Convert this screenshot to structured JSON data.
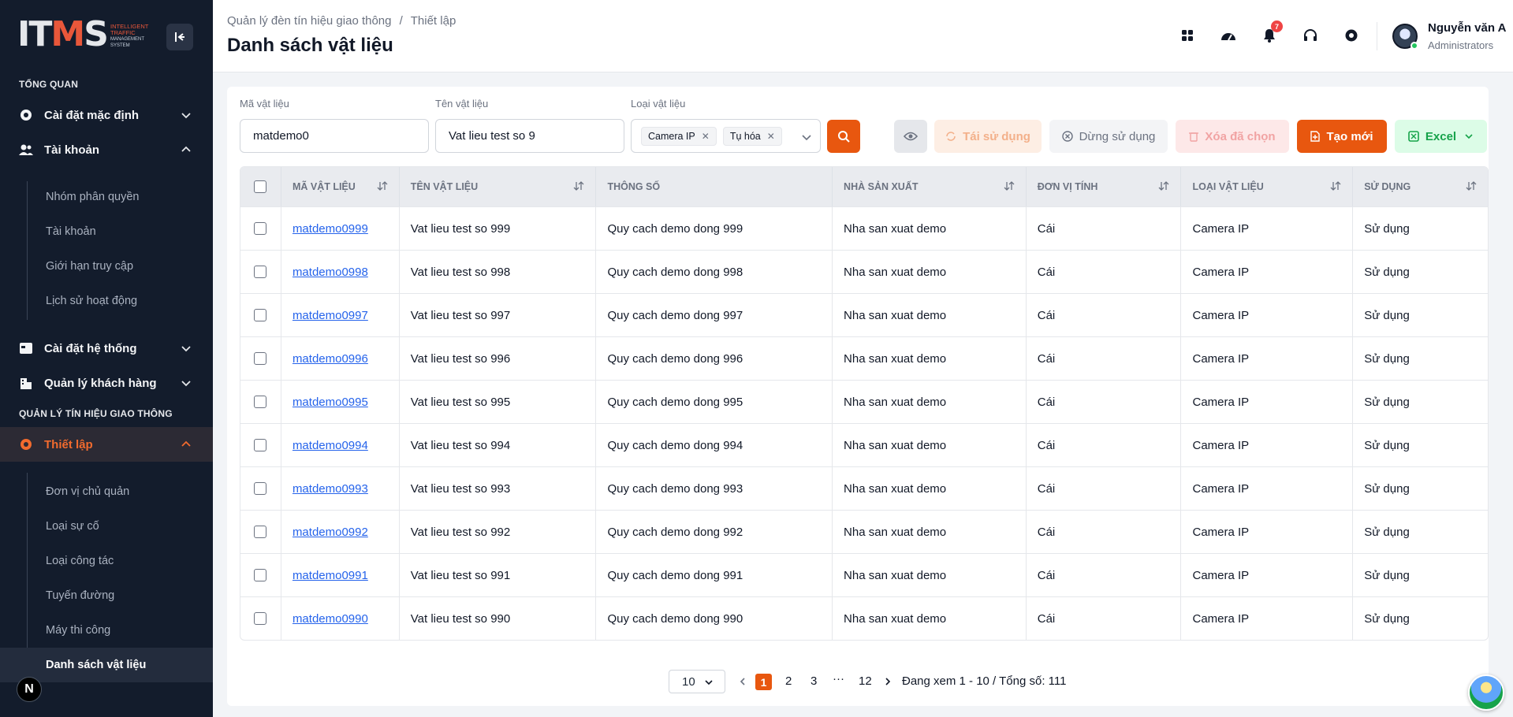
{
  "logo": {
    "main_a": "IT",
    "main_b": "M",
    "main_c": "S",
    "sub1": "INTELLIGENT",
    "sub2": "TRAFFIC",
    "sub3": "MANAGEMENT",
    "sub4": "SYSTEM"
  },
  "sidebar": {
    "section_overview": "TỔNG QUAN",
    "menu_default_settings": "Cài đặt mặc định",
    "menu_account": "Tài khoản",
    "account_sub": [
      "Nhóm phân quyền",
      "Tài khoản",
      "Giới hạn truy cập",
      "Lịch sử hoạt động"
    ],
    "menu_system_settings": "Cài đặt hệ thống",
    "menu_customers": "Quản lý khách hàng",
    "section_traffic": "QUẢN LÝ TÍN HIỆU GIAO THÔNG",
    "menu_setup": "Thiết lập",
    "setup_sub": [
      "Đơn vị chủ quản",
      "Loại sự cố",
      "Loại công tác",
      "Tuyến đường",
      "Máy thi công",
      "Danh sách vật liệu"
    ],
    "n_badge": "N"
  },
  "header": {
    "breadcrumb_root": "Quản lý đèn tín hiệu giao thông",
    "breadcrumb_sep": "/",
    "breadcrumb_current": "Thiết lập",
    "page_title": "Danh sách vật liệu",
    "notification_count": "7",
    "user_name": "Nguyễn văn A",
    "user_role": "Administrators"
  },
  "filters": {
    "code_label": "Mã vật liệu",
    "code_value": "matdemo0",
    "name_label": "Tên vật liệu",
    "name_value": "Vat lieu test so 9",
    "type_label": "Loại vật liệu",
    "type_tags": [
      "Camera IP",
      "Tụ hóa"
    ]
  },
  "toolbar": {
    "reuse_label": "Tái sử dụng",
    "stop_label": "Dừng sử dụng",
    "delete_label": "Xóa đã chọn",
    "create_label": "Tạo mới",
    "excel_label": "Excel"
  },
  "colors": {
    "accent": "#e8570f",
    "sidebar_bg": "#131c2c",
    "link": "#2563eb"
  },
  "table": {
    "headers": [
      "MÃ VẬT LIỆU",
      "TÊN VẬT LIỆU",
      "THÔNG SỐ",
      "NHÀ SẢN XUẤT",
      "ĐƠN VỊ TÍNH",
      "LOẠI VẬT LIỆU",
      "SỬ DỤNG"
    ],
    "rows": [
      [
        "matdemo0999",
        "Vat lieu test so 999",
        "Quy cach demo dong 999",
        "Nha san xuat demo",
        "Cái",
        "Camera IP",
        "Sử dụng"
      ],
      [
        "matdemo0998",
        "Vat lieu test so 998",
        "Quy cach demo dong 998",
        "Nha san xuat demo",
        "Cái",
        "Camera IP",
        "Sử dụng"
      ],
      [
        "matdemo0997",
        "Vat lieu test so 997",
        "Quy cach demo dong 997",
        "Nha san xuat demo",
        "Cái",
        "Camera IP",
        "Sử dụng"
      ],
      [
        "matdemo0996",
        "Vat lieu test so 996",
        "Quy cach demo dong 996",
        "Nha san xuat demo",
        "Cái",
        "Camera IP",
        "Sử dụng"
      ],
      [
        "matdemo0995",
        "Vat lieu test so 995",
        "Quy cach demo dong 995",
        "Nha san xuat demo",
        "Cái",
        "Camera IP",
        "Sử dụng"
      ],
      [
        "matdemo0994",
        "Vat lieu test so 994",
        "Quy cach demo dong 994",
        "Nha san xuat demo",
        "Cái",
        "Camera IP",
        "Sử dụng"
      ],
      [
        "matdemo0993",
        "Vat lieu test so 993",
        "Quy cach demo dong 993",
        "Nha san xuat demo",
        "Cái",
        "Camera IP",
        "Sử dụng"
      ],
      [
        "matdemo0992",
        "Vat lieu test so 992",
        "Quy cach demo dong 992",
        "Nha san xuat demo",
        "Cái",
        "Camera IP",
        "Sử dụng"
      ],
      [
        "matdemo0991",
        "Vat lieu test so 991",
        "Quy cach demo dong 991",
        "Nha san xuat demo",
        "Cái",
        "Camera IP",
        "Sử dụng"
      ],
      [
        "matdemo0990",
        "Vat lieu test so 990",
        "Quy cach demo dong 990",
        "Nha san xuat demo",
        "Cái",
        "Camera IP",
        "Sử dụng"
      ]
    ]
  },
  "pagination": {
    "page_size": "10",
    "pages": [
      "1",
      "2",
      "3",
      "12"
    ],
    "ellipsis": "···",
    "current_page": "1",
    "info": "Đang xem 1 - 10 / Tổng số: 111"
  }
}
